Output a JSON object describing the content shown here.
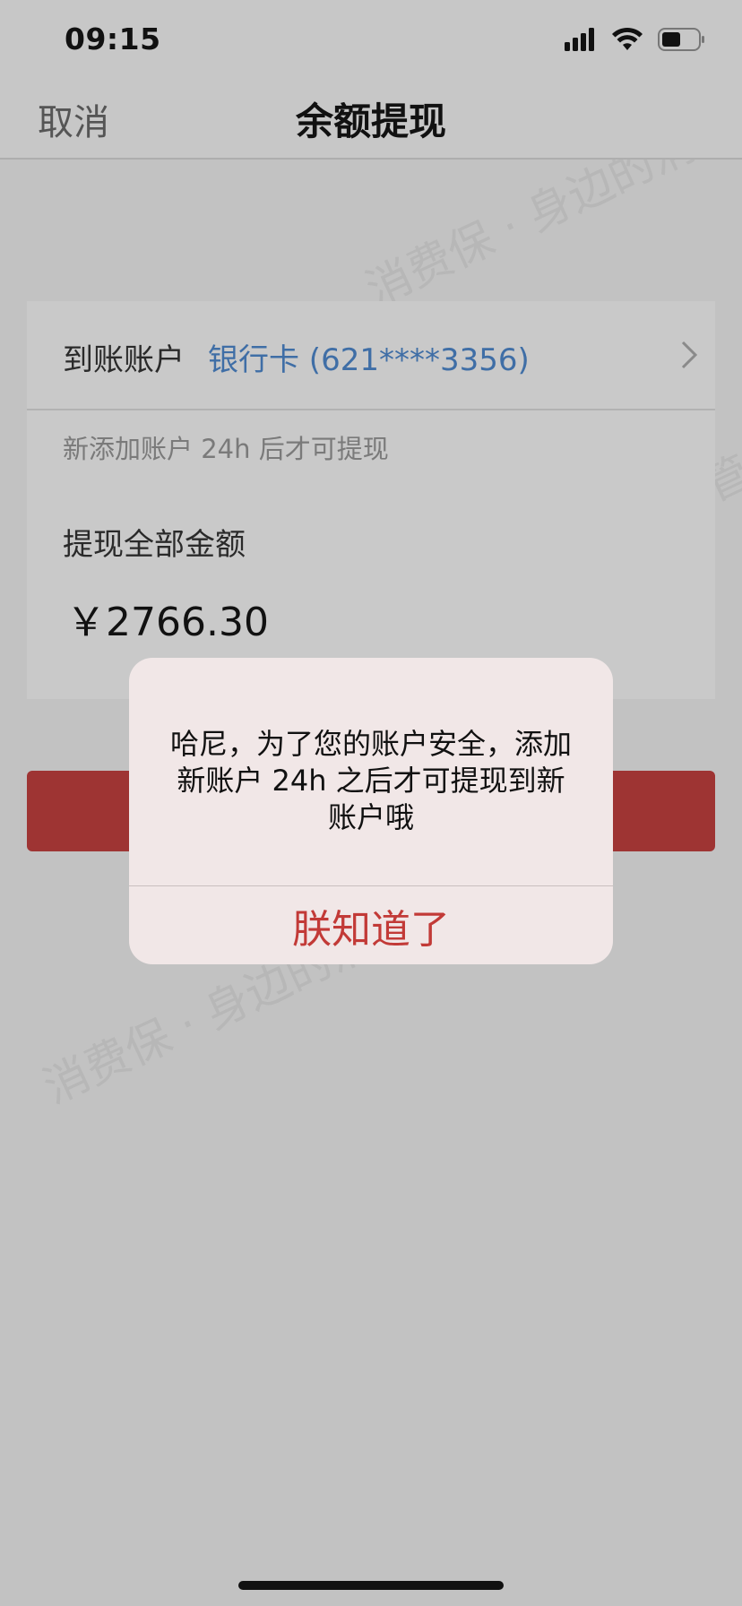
{
  "status_bar": {
    "time": "09:15",
    "icons": [
      "signal-icon",
      "wifi-icon",
      "battery-icon"
    ],
    "battery_level": 0.5
  },
  "nav": {
    "cancel_label": "取消",
    "title": "余额提现"
  },
  "account": {
    "label": "到账账户",
    "value": "银行卡 (621****3356)",
    "note": "新添加账户 24h 后才可提现",
    "value_color": "#3f6ea6"
  },
  "amount": {
    "label": "提现全部金额",
    "value": "￥2766.30"
  },
  "watermark": {
    "text": "消费保 · 身边的消费服务管家"
  },
  "dialog": {
    "message": "哈尼，为了您的账户安全，添加新账户 24h 之后才可提现到新账户哦",
    "button_label": "朕知道了",
    "button_color": "#c23a37"
  },
  "colors": {
    "background": "#c2c2c2",
    "button_red": "#9e3433",
    "dialog_bg": "#f1e7e7"
  }
}
